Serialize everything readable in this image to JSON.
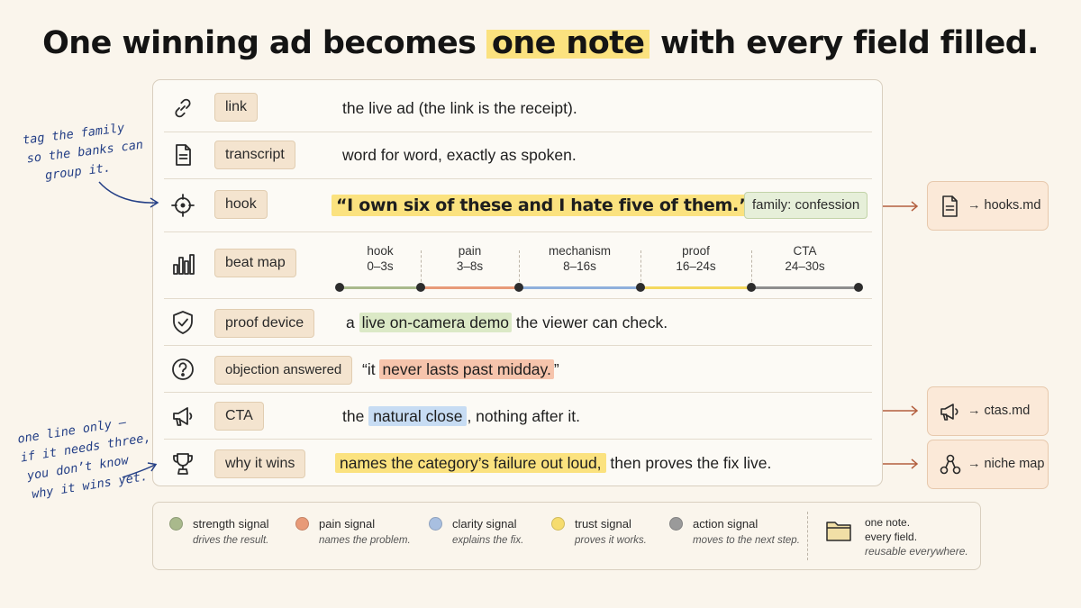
{
  "title": {
    "prefix": "One winning ad becomes ",
    "highlight": "one note",
    "suffix": " with every field filled."
  },
  "rows": {
    "link": {
      "label": "link",
      "icon": "link-icon",
      "value": "the live ad (the link is the receipt)."
    },
    "transcript": {
      "label": "transcript",
      "icon": "document-icon",
      "value": "word for word, exactly as spoken."
    },
    "hook": {
      "label": "hook",
      "icon": "crosshair-icon",
      "value": "“I own six of these and I hate five of them.”",
      "family": "family: confession"
    },
    "beat_map": {
      "label": "beat map",
      "icon": "bar-chart-icon",
      "beats": [
        {
          "name": "hook",
          "range": "0–3s",
          "color": "#a9b98c"
        },
        {
          "name": "pain",
          "range": "3–8s",
          "color": "#e89a78"
        },
        {
          "name": "mechanism",
          "range": "8–16s",
          "color": "#8fb0dc"
        },
        {
          "name": "proof",
          "range": "16–24s",
          "color": "#f4d85e"
        },
        {
          "name": "CTA",
          "range": "24–30s",
          "color": "#8e8e8e"
        }
      ]
    },
    "proof_device": {
      "label": "proof device",
      "icon": "shield-check-icon",
      "pre": "a ",
      "mark": "live on-camera demo",
      "post": " the viewer can check."
    },
    "objection": {
      "label": "objection answered",
      "icon": "question-icon",
      "pre": "“it ",
      "mark": "never lasts past midday.",
      "post": "”"
    },
    "cta": {
      "label": "CTA",
      "icon": "megaphone-icon",
      "pre": "the ",
      "mark": "natural close",
      "post": ", nothing after it."
    },
    "why": {
      "label": "why it wins",
      "icon": "trophy-icon",
      "mark": "names the category’s failure out loud,",
      "post": " then proves the fix live."
    }
  },
  "outputs": [
    {
      "icon": "document-icon",
      "text": "→ hooks.md"
    },
    {
      "icon": "megaphone-icon",
      "text": "→ ctas.md"
    },
    {
      "icon": "network-icon",
      "text": "→ niche map"
    }
  ],
  "notes": {
    "top": [
      "tag the family",
      "so the banks can",
      "group it."
    ],
    "bottom": [
      "one line only —",
      "if it needs three,",
      "you don’t know",
      "why it wins yet."
    ]
  },
  "legend": {
    "signals": [
      {
        "name": "strength signal",
        "desc": "drives the result.",
        "color": "#a9b98c"
      },
      {
        "name": "pain signal",
        "desc": "names the problem.",
        "color": "#e89a78"
      },
      {
        "name": "clarity signal",
        "desc": "explains the fix.",
        "color": "#a8bfe0"
      },
      {
        "name": "trust signal",
        "desc": "proves it works.",
        "color": "#f6dc6e"
      },
      {
        "name": "action signal",
        "desc": "moves to the next step.",
        "color": "#9a9a9a"
      }
    ],
    "summary": [
      "one note.",
      "every field.",
      "reusable everywhere."
    ],
    "summary_icon": "folder-icon"
  }
}
